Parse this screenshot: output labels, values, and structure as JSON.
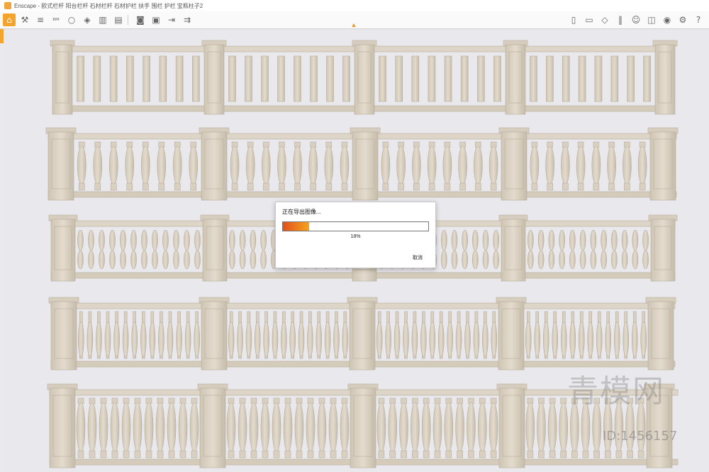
{
  "window": {
    "title": "Enscape - 欧式栏杆 阳台栏杆 石材栏杆 石材护栏 扶手 围栏 护栏 宝瓶柱子2"
  },
  "toolbar": {
    "left_icons": [
      "home-icon",
      "tools-icon",
      "list-icon",
      "bim-icon",
      "bubble-icon",
      "drop-icon",
      "building-icon",
      "clapper-icon",
      "camera-icon",
      "gallery-icon",
      "export-icon",
      "batch-export-icon"
    ],
    "right_icons": [
      "book-icon",
      "view-icon",
      "cube-icon",
      "books-icon",
      "person-icon",
      "capture-icon",
      "eye-icon",
      "gear-icon",
      "help-icon"
    ],
    "bim_label": "BIM",
    "help_label": "?"
  },
  "dialog": {
    "title": "正在导出图像...",
    "progress": 0.18,
    "progress_text": "18%",
    "cancel_label": "取消"
  },
  "watermark": {
    "logo": "青模网",
    "id_text": "ID:1456157"
  },
  "colors": {
    "accent": "#f4a42b",
    "stone": "#d9d0c2",
    "progress_start": "#e2511c",
    "progress_end": "#f6a31d"
  }
}
